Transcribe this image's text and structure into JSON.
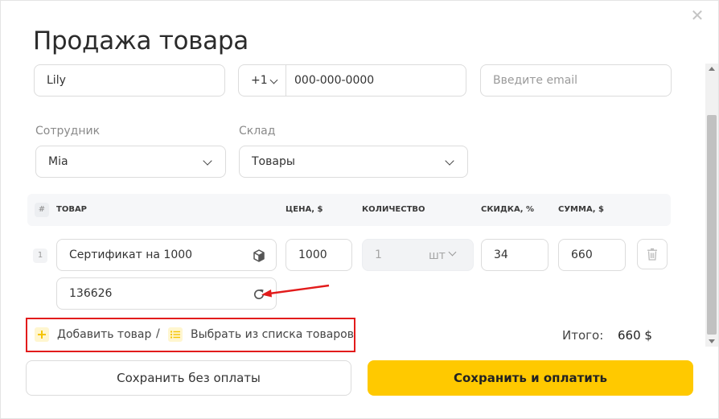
{
  "modal": {
    "title": "Продажа товара",
    "close_icon": "close-icon"
  },
  "client": {
    "name_value": "Lily",
    "phone_code": "+1",
    "phone_placeholder": "000-000-0000",
    "email_placeholder": "Введите email"
  },
  "employee": {
    "label": "Сотрудник",
    "value": "Mia"
  },
  "warehouse": {
    "label": "Склад",
    "value": "Товары"
  },
  "table": {
    "headers": {
      "hash": "#",
      "product": "ТОВАР",
      "price": "ЦЕНА, $",
      "quantity": "КОЛИЧЕСТВО",
      "discount": "СКИДКА, %",
      "sum": "СУММА, $"
    },
    "rows": [
      {
        "num": "1",
        "product": "Сертификат на 1000",
        "code": "136626",
        "price": "1000",
        "quantity": "1",
        "unit": "шт",
        "discount": "34",
        "sum": "660"
      }
    ]
  },
  "actions": {
    "add_product": "Добавить товар",
    "separator": "/",
    "choose_from_list": "Выбрать из списка товаров"
  },
  "total": {
    "label": "Итого:",
    "value": "660 $"
  },
  "buttons": {
    "save_without_payment": "Сохранить без оплаты",
    "save_and_pay": "Сохранить и оплатить"
  },
  "colors": {
    "accent": "#ffc900",
    "highlight_box": "#e21b1b"
  }
}
